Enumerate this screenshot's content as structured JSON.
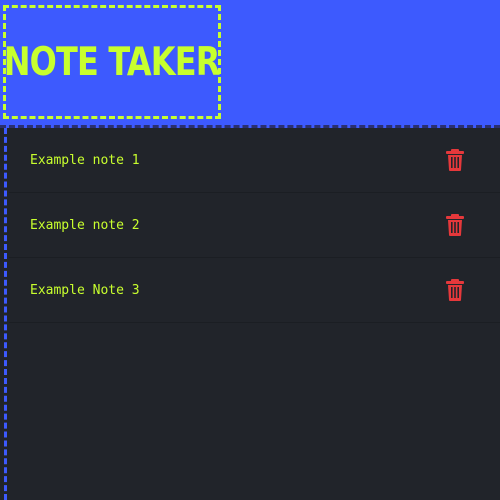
{
  "app": {
    "title": "Note Taker"
  },
  "colors": {
    "header_bg": "#3d5afe",
    "accent": "#c8ff2e",
    "content_bg": "#21242a",
    "delete": "#e5383b"
  },
  "notes": [
    {
      "title": "Example note 1",
      "delete_icon": "trash-icon"
    },
    {
      "title": "Example note 2",
      "delete_icon": "trash-icon"
    },
    {
      "title": "Example Note 3",
      "delete_icon": "trash-icon"
    }
  ]
}
